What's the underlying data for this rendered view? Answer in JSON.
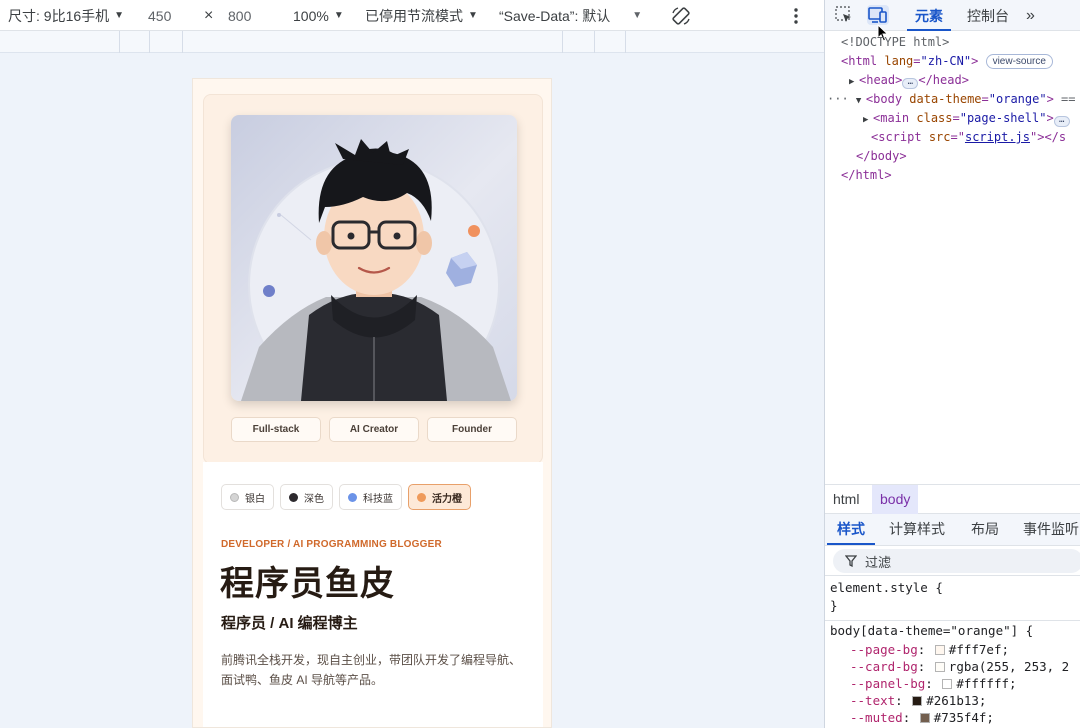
{
  "toolbar": {
    "dimensions_label": "尺寸: 9比16手机",
    "width": "450",
    "times": "×",
    "height": "800",
    "zoom": "100%",
    "throttle": "已停用节流模式",
    "save_data_label": "“Save-Data”: 默认"
  },
  "page": {
    "tags": [
      "Full-stack",
      "AI Creator",
      "Founder"
    ],
    "themes": [
      {
        "label": "银白",
        "color": "#d4d4d4"
      },
      {
        "label": "深色",
        "color": "#2d2a2e"
      },
      {
        "label": "科技蓝",
        "color": "#6b93e8"
      },
      {
        "label": "活力橙",
        "color": "#ef9a5a"
      }
    ],
    "eyebrow": "DEVELOPER / AI PROGRAMMING BLOGGER",
    "name": "程序员鱼皮",
    "subtitle": "程序员 / AI 编程博主",
    "bio": "前腾讯全栈开发，现自主创业，带团队开发了编程导航、面试鸭、鱼皮 AI 导航等产品。"
  },
  "devtools": {
    "tabs": {
      "elements": "元素",
      "console": "控制台"
    },
    "dom": {
      "doctype": "<!DOCTYPE html>",
      "html_open_tag": "html",
      "html_lang_attr": "lang",
      "html_lang_val": "\"zh-CN\"",
      "view_source": "view-source",
      "head_open": "<head>",
      "head_close": "</head>",
      "body_tag": "body",
      "body_attr": "data-theme",
      "body_val": "\"orange\"",
      "body_eq": "==",
      "main_tag": "main",
      "main_attr": "class",
      "main_val": "\"page-shell\"",
      "script_tag": "script",
      "script_attr": "src",
      "script_val": "script.js",
      "body_close": "</body>",
      "html_close": "</html>"
    },
    "breadcrumbs": [
      "html",
      "body"
    ],
    "style_tabs": [
      "样式",
      "计算样式",
      "布局",
      "事件监听"
    ],
    "filter_placeholder": "过滤",
    "styles": {
      "element_style": "element.style {",
      "close_brace": "}",
      "rule_selector": "body[data-theme=\"orange\"] {",
      "props": [
        {
          "name": "--page-bg",
          "value": "#fff7ef;",
          "color": "#fff7ef"
        },
        {
          "name": "--card-bg",
          "value": "rgba(255, 253, 2",
          "color": "#fffdf8"
        },
        {
          "name": "--panel-bg",
          "value": "#ffffff;",
          "color": "#ffffff"
        },
        {
          "name": "--text",
          "value": "#261b13;",
          "color": "#261b13"
        },
        {
          "name": "--muted",
          "value": "#735f4f;",
          "color": "#735f4f"
        }
      ]
    }
  }
}
